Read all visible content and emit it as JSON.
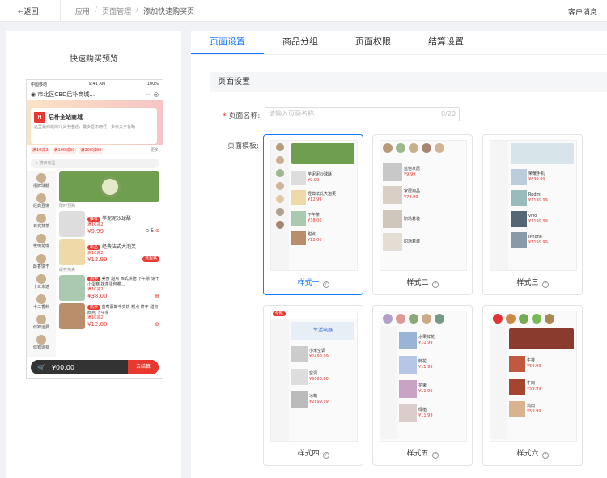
{
  "topbar": {
    "back": "←返回",
    "crumbs": [
      "应用",
      "页面管理",
      "添加快速购买页"
    ],
    "right": "客户消息"
  },
  "left": {
    "title": "快速购买预览",
    "phone": {
      "status_left": "中国移动",
      "time": "9:41 AM",
      "battery": "100%",
      "location": "市北区CBD后朴商城...",
      "store": "后朴全站商城",
      "desc": "这里是商城简介文字描述，最多显示两行，多余文字省略",
      "coupons": [
        "满10减2",
        "满100减30",
        "满200减80"
      ],
      "more": "更多",
      "search": "搜索商品",
      "cats": [
        "招牌球髓",
        "经典豆饼",
        "日式抹茶",
        "玫瑰花饼",
        "酥香饼干",
        "十三米遂",
        "十三香料",
        "似锦运费",
        "似锦运费"
      ],
      "section1": "限时预购",
      "section2": "缓存热卖",
      "products": [
        {
          "tag": "推荐",
          "name": "芋泥泥沙球酥",
          "sub": "满10减2",
          "price": "¥9.99",
          "qty": "5"
        },
        {
          "tag": "新品",
          "name": "经典法式大泡芙",
          "sub": "满10减2",
          "price": "¥12.99",
          "btn": "选规格"
        },
        {
          "tag": "热卖",
          "name": "美食 甜点 西式烘焙 下午茶 饼干 小蛋糕 抹茶蛋包卷...",
          "sub": "满10减2",
          "price": "¥38.00"
        },
        {
          "tag": "热卖",
          "name": "蓝莓慕斯千夹饼 糕点 饼干 甜点 西点 下午茶",
          "sub": "满10减2",
          "price": "¥12.00"
        }
      ],
      "cart_total": "¥00.00",
      "checkout": "去结算"
    }
  },
  "tabs": [
    "页面设置",
    "商品分组",
    "页面权限",
    "结算设置"
  ],
  "section_title": "页面设置",
  "form": {
    "name_label": "页面名称:",
    "name_placeholder": "请输入页面名称",
    "name_count": "0/20",
    "template_label": "页面模板:"
  },
  "templates": [
    {
      "label": "样式一",
      "selected": true
    },
    {
      "label": "样式二",
      "selected": false
    },
    {
      "label": "样式三",
      "selected": false
    },
    {
      "label": "样式四",
      "selected": false
    },
    {
      "label": "样式五",
      "selected": false
    },
    {
      "label": "样式六",
      "selected": false
    }
  ],
  "mini": {
    "price1": "¥9.99",
    "price2": "¥12.99",
    "price3": "¥78.99",
    "price4": "¥899.99",
    "price5": "¥1199.99",
    "price6": "¥2499.99",
    "price7": "¥3999.99",
    "price8": "¥2899.99",
    "price9": "¥11.99",
    "price10": "¥59.99",
    "banner4": "生活电器",
    "t1": "芋泥泥沙球酥",
    "t2": "经典法式大泡芙",
    "t3": "荣耀手机",
    "t4": "小米空调",
    "t5": "水果鲜花"
  },
  "colors": {
    "accent": "#1677ff",
    "brand": "#e8382f"
  }
}
